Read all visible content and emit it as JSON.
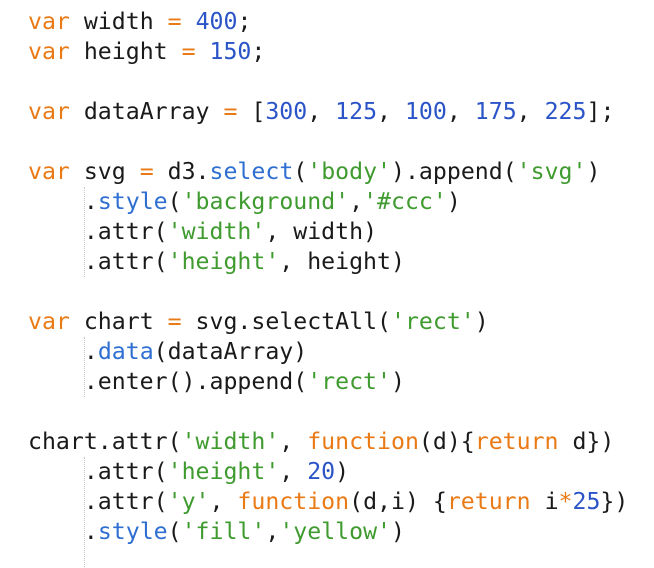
{
  "editor": {
    "colors": {
      "background": "#ffffff",
      "plain": "#1a1a1a",
      "keyword": "#ea7a16",
      "number": "#2a54c7",
      "string": "#3f9b2f",
      "method": "#2e6fd1",
      "indent_guide": "#c9c9c9"
    },
    "lines": [
      [
        {
          "t": "var",
          "k": "kw"
        },
        {
          "t": " width ",
          "k": "plain"
        },
        {
          "t": "=",
          "k": "op"
        },
        {
          "t": " ",
          "k": "plain"
        },
        {
          "t": "400",
          "k": "num"
        },
        {
          "t": ";",
          "k": "plain"
        }
      ],
      [
        {
          "t": "var",
          "k": "kw"
        },
        {
          "t": " height ",
          "k": "plain"
        },
        {
          "t": "=",
          "k": "op"
        },
        {
          "t": " ",
          "k": "plain"
        },
        {
          "t": "150",
          "k": "num"
        },
        {
          "t": ";",
          "k": "plain"
        }
      ],
      [],
      [
        {
          "t": "var",
          "k": "kw"
        },
        {
          "t": " dataArray ",
          "k": "plain"
        },
        {
          "t": "=",
          "k": "op"
        },
        {
          "t": " [",
          "k": "plain"
        },
        {
          "t": "300",
          "k": "num"
        },
        {
          "t": ", ",
          "k": "plain"
        },
        {
          "t": "125",
          "k": "num"
        },
        {
          "t": ", ",
          "k": "plain"
        },
        {
          "t": "100",
          "k": "num"
        },
        {
          "t": ", ",
          "k": "plain"
        },
        {
          "t": "175",
          "k": "num"
        },
        {
          "t": ", ",
          "k": "plain"
        },
        {
          "t": "225",
          "k": "num"
        },
        {
          "t": "];",
          "k": "plain"
        }
      ],
      [],
      [
        {
          "t": "var",
          "k": "kw"
        },
        {
          "t": " svg ",
          "k": "plain"
        },
        {
          "t": "=",
          "k": "op"
        },
        {
          "t": " d3.",
          "k": "plain"
        },
        {
          "t": "select",
          "k": "fn"
        },
        {
          "t": "(",
          "k": "plain"
        },
        {
          "t": "'body'",
          "k": "str"
        },
        {
          "t": ").append(",
          "k": "plain"
        },
        {
          "t": "'svg'",
          "k": "str"
        },
        {
          "t": ")",
          "k": "plain"
        }
      ],
      [
        {
          "t": "    .",
          "k": "plain"
        },
        {
          "t": "style",
          "k": "fn"
        },
        {
          "t": "(",
          "k": "plain"
        },
        {
          "t": "'background'",
          "k": "str"
        },
        {
          "t": ",",
          "k": "plain"
        },
        {
          "t": "'#ccc'",
          "k": "str"
        },
        {
          "t": ")",
          "k": "plain"
        }
      ],
      [
        {
          "t": "    .attr(",
          "k": "plain"
        },
        {
          "t": "'width'",
          "k": "str"
        },
        {
          "t": ", width)",
          "k": "plain"
        }
      ],
      [
        {
          "t": "    .attr(",
          "k": "plain"
        },
        {
          "t": "'height'",
          "k": "str"
        },
        {
          "t": ", height)",
          "k": "plain"
        }
      ],
      [],
      [
        {
          "t": "var",
          "k": "kw"
        },
        {
          "t": " chart ",
          "k": "plain"
        },
        {
          "t": "=",
          "k": "op"
        },
        {
          "t": " svg.selectAll(",
          "k": "plain"
        },
        {
          "t": "'rect'",
          "k": "str"
        },
        {
          "t": ")",
          "k": "plain"
        }
      ],
      [
        {
          "t": "    .",
          "k": "plain"
        },
        {
          "t": "data",
          "k": "fn"
        },
        {
          "t": "(dataArray)",
          "k": "plain"
        }
      ],
      [
        {
          "t": "    .enter().append(",
          "k": "plain"
        },
        {
          "t": "'rect'",
          "k": "str"
        },
        {
          "t": ")",
          "k": "plain"
        }
      ],
      [],
      [
        {
          "t": "chart.attr(",
          "k": "plain"
        },
        {
          "t": "'width'",
          "k": "str"
        },
        {
          "t": ", ",
          "k": "plain"
        },
        {
          "t": "function",
          "k": "kw"
        },
        {
          "t": "(d){",
          "k": "plain"
        },
        {
          "t": "return",
          "k": "kw"
        },
        {
          "t": " d})",
          "k": "plain"
        }
      ],
      [
        {
          "t": "    .attr(",
          "k": "plain"
        },
        {
          "t": "'height'",
          "k": "str"
        },
        {
          "t": ", ",
          "k": "plain"
        },
        {
          "t": "20",
          "k": "num"
        },
        {
          "t": ")",
          "k": "plain"
        }
      ],
      [
        {
          "t": "    .attr(",
          "k": "plain"
        },
        {
          "t": "'y'",
          "k": "str"
        },
        {
          "t": ", ",
          "k": "plain"
        },
        {
          "t": "function",
          "k": "kw"
        },
        {
          "t": "(d,i) {",
          "k": "plain"
        },
        {
          "t": "return",
          "k": "kw"
        },
        {
          "t": " i",
          "k": "plain"
        },
        {
          "t": "*",
          "k": "op"
        },
        {
          "t": "25",
          "k": "num"
        },
        {
          "t": "})",
          "k": "plain"
        }
      ],
      [
        {
          "t": "    .",
          "k": "plain"
        },
        {
          "t": "style",
          "k": "fn"
        },
        {
          "t": "(",
          "k": "plain"
        },
        {
          "t": "'fill'",
          "k": "str"
        },
        {
          "t": ",",
          "k": "plain"
        },
        {
          "t": "'yellow'",
          "k": "str"
        },
        {
          "t": ")",
          "k": "plain"
        }
      ]
    ]
  }
}
